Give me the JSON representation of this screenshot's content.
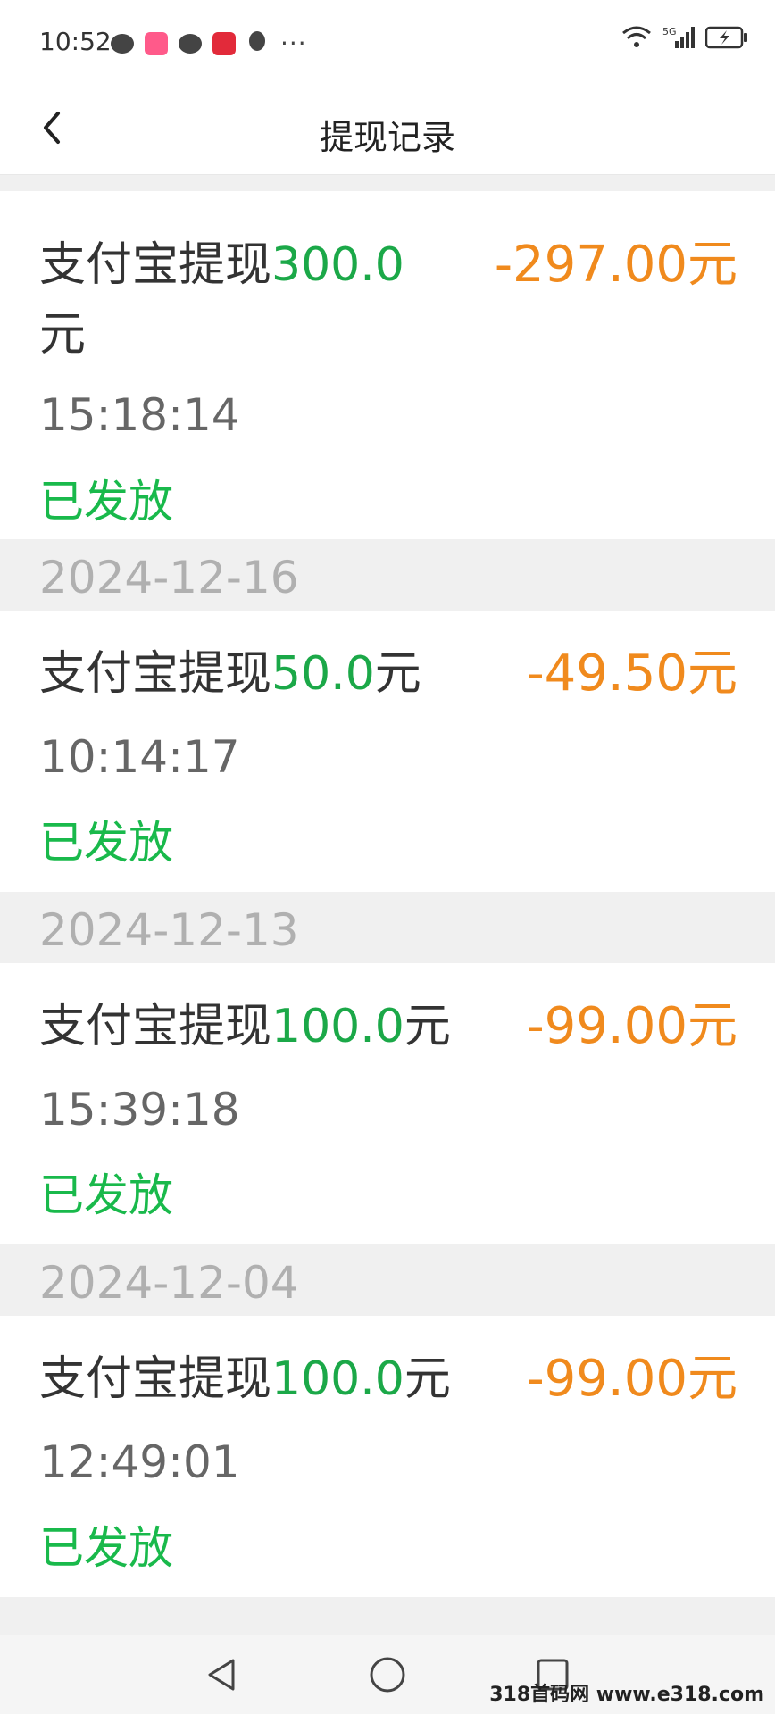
{
  "status_bar": {
    "time": "10:52",
    "network": "5G"
  },
  "header": {
    "title": "提现记录"
  },
  "records": [
    {
      "title_prefix": "支付宝提现",
      "amount": "300.0",
      "unit": "元",
      "delta": "-297.00元",
      "time": "15:18:14",
      "status": "已发放"
    },
    {
      "date": "2024-12-16",
      "title_prefix": "支付宝提现",
      "amount": "50.0",
      "unit": "元",
      "delta": "-49.50元",
      "time": "10:14:17",
      "status": "已发放"
    },
    {
      "date": "2024-12-13",
      "title_prefix": "支付宝提现",
      "amount": "100.0",
      "unit": "元",
      "delta": "-99.00元",
      "time": "15:39:18",
      "status": "已发放"
    },
    {
      "date": "2024-12-04",
      "title_prefix": "支付宝提现",
      "amount": "100.0",
      "unit": "元",
      "delta": "-99.00元",
      "time": "12:49:01",
      "status": "已发放"
    }
  ],
  "watermark": "318首码网 www.e318.com",
  "colors": {
    "amount_green": "#1ba848",
    "delta_orange": "#f08a1d",
    "status_green": "#19b94b",
    "date_gray": "#b0b0b0"
  }
}
